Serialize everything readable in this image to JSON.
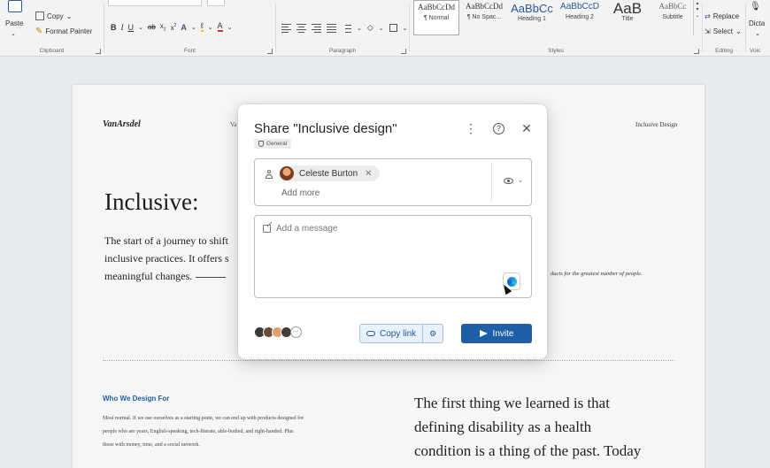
{
  "ribbon": {
    "clipboard": {
      "paste": "Paste",
      "copy": "Copy",
      "format_painter": "Format Painter",
      "label": "Clipboard"
    },
    "font": {
      "bold": "B",
      "italic": "I",
      "underline": "U",
      "strike": "ab",
      "sub": "x",
      "sup": "x",
      "font_color": "A",
      "highlight": "ℓ",
      "label": "Font"
    },
    "paragraph": {
      "label": "Paragraph",
      "pilcrow": "¶"
    },
    "styles": {
      "items": [
        {
          "sample": "AaBbCcDd",
          "name": "¶ Normal",
          "selected": true
        },
        {
          "sample": "AaBbCcDd",
          "name": "¶ No Spac...",
          "selected": false
        },
        {
          "sample": "AaBbCc",
          "name": "Heading 1",
          "selected": false
        },
        {
          "sample": "AaBbCcD",
          "name": "Heading 2",
          "selected": false
        },
        {
          "sample": "AaB",
          "name": "Title",
          "selected": false
        },
        {
          "sample": "AaBbCc",
          "name": "Subtitle",
          "selected": false
        }
      ],
      "label": "Styles"
    },
    "editing": {
      "replace": "Replace",
      "select": "Select",
      "label": "Editing"
    },
    "voice": {
      "dictate": "Dicta",
      "label": "Voic"
    }
  },
  "document": {
    "logo": "VanArsdel",
    "logo_trunc": "Va",
    "header_right": "Inclusive Design",
    "heading": "Inclusive:",
    "intro_lines": [
      "The start of a journey to shift",
      "inclusive practices. It offers s",
      "meaningful changes."
    ],
    "caption": "ducts for the greatest number of people.",
    "section_heading": "Who We Design For",
    "section_body": [
      "Most normal. If we use ourselves as a starting point, we can end up with products designed for",
      "people who are years, English-speaking, tech-literate, able-bodied, and right-handed. Plus",
      "those with money, time, and a social network."
    ],
    "quote_lines": [
      "The first thing we learned is that",
      "defining disability as a health",
      "condition is a thing of the past. Today"
    ]
  },
  "share_dialog": {
    "title": "Share \"Inclusive design\"",
    "sensitivity_badge": "General",
    "recipient": "Celeste Burton",
    "add_more_placeholder": "Add a message",
    "add_more": "Add more",
    "message_placeholder": "Add a message",
    "copy_link": "Copy link",
    "invite": "Invite",
    "more_avatars": "···"
  },
  "colors": {
    "accent": "#1f5fa8",
    "section_heading": "#1f5fa8",
    "copy_link_bg": "#e9f2fb"
  }
}
